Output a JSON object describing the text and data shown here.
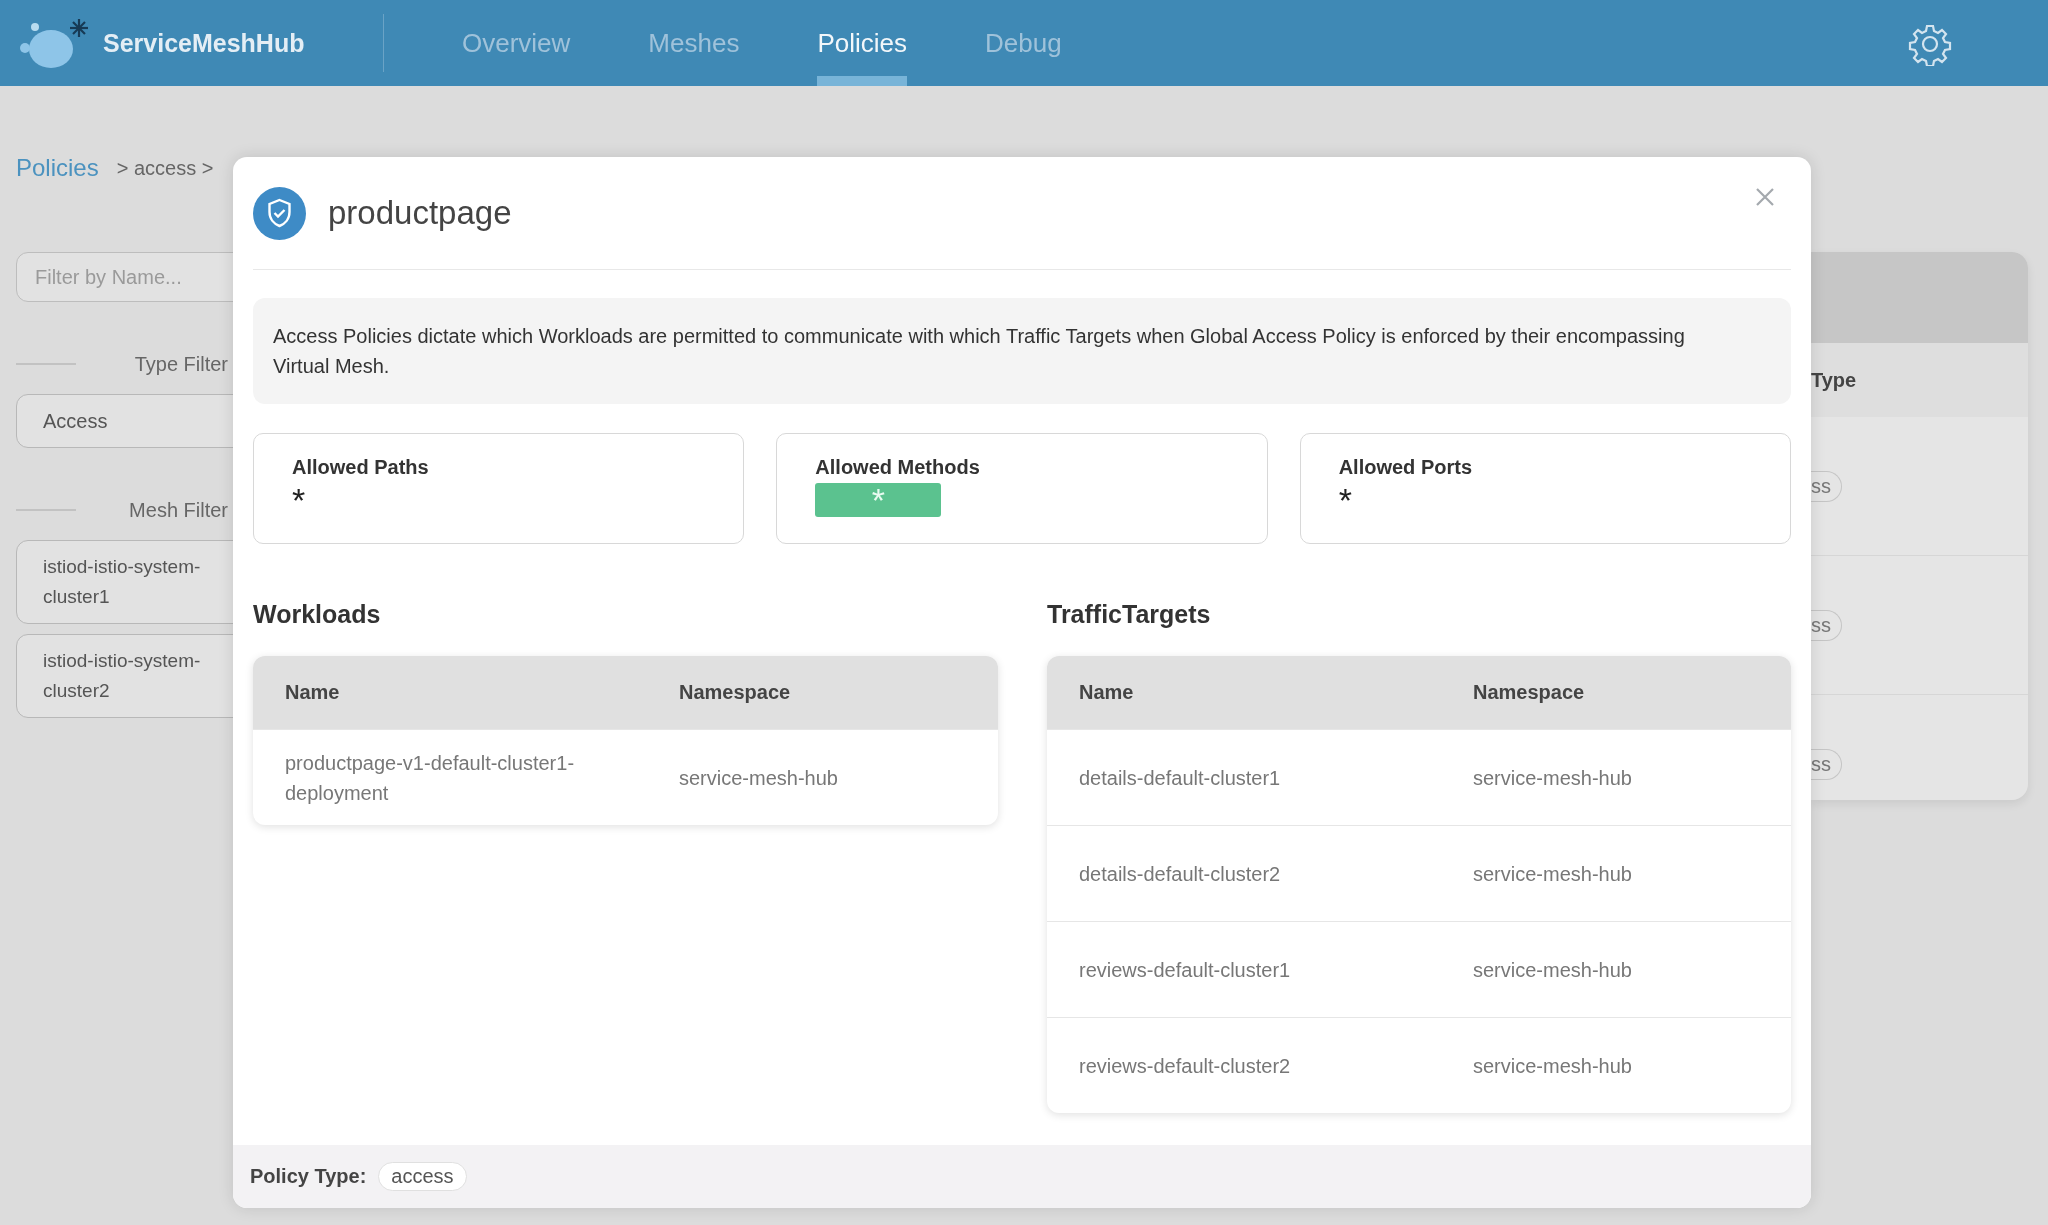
{
  "header": {
    "brand": "ServiceMeshHub",
    "tabs": [
      {
        "label": "Overview",
        "selected": false
      },
      {
        "label": "Meshes",
        "selected": false
      },
      {
        "label": "Policies",
        "selected": true
      },
      {
        "label": "Debug",
        "selected": false
      }
    ]
  },
  "breadcrumb": {
    "root": "Policies",
    "trail": "> access >"
  },
  "sidebar": {
    "search": {
      "placeholder": "Filter by Name..."
    },
    "filters": [
      {
        "label": "Type Filter",
        "options": [
          "Access"
        ]
      },
      {
        "label": "Mesh Filter",
        "options": [
          "istiod-istio-system-cluster1",
          "istiod-istio-system-cluster2"
        ]
      }
    ]
  },
  "background_table": {
    "column": "Type",
    "cells": [
      "ss",
      "ss",
      "ss"
    ]
  },
  "modal": {
    "title": "productpage",
    "description": "Access Policies dictate which Workloads are permitted to communicate with which Traffic Targets when Global Access Policy is enforced by their encompassing Virtual Mesh.",
    "rules": [
      {
        "label": "Allowed Paths",
        "value": "*",
        "highlighted": false
      },
      {
        "label": "Allowed Methods",
        "value": "*",
        "highlighted": true
      },
      {
        "label": "Allowed Ports",
        "value": "*",
        "highlighted": false
      }
    ],
    "workloads": {
      "heading": "Workloads",
      "columns": [
        "Name",
        "Namespace"
      ],
      "rows": [
        [
          "productpage-v1-default-cluster1-deployment",
          "service-mesh-hub"
        ]
      ]
    },
    "traffic_targets": {
      "heading": "TrafficTargets",
      "columns": [
        "Name",
        "Namespace"
      ],
      "rows": [
        [
          "details-default-cluster1",
          "service-mesh-hub"
        ],
        [
          "details-default-cluster2",
          "service-mesh-hub"
        ],
        [
          "reviews-default-cluster1",
          "service-mesh-hub"
        ],
        [
          "reviews-default-cluster2",
          "service-mesh-hub"
        ]
      ]
    },
    "footer": {
      "label": "Policy Type:",
      "value": "access"
    }
  }
}
